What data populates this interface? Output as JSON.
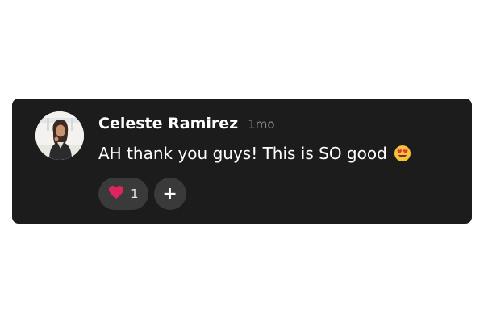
{
  "comment": {
    "author": "Celeste Ramirez",
    "time": "1mo",
    "message": "AH thank you guys! This is SO good",
    "message_emoji": "smiling-face-with-heart-eyes-icon"
  },
  "reactions": {
    "items": [
      {
        "icon": "red-heart-icon",
        "count": "1"
      }
    ],
    "add_label": "+"
  },
  "colors": {
    "card_background": "#1c1c1c",
    "pill_background": "#3a3a3a",
    "text": "#ffffff",
    "muted_text": "#8a8a8a",
    "heart": "#e0245e"
  }
}
